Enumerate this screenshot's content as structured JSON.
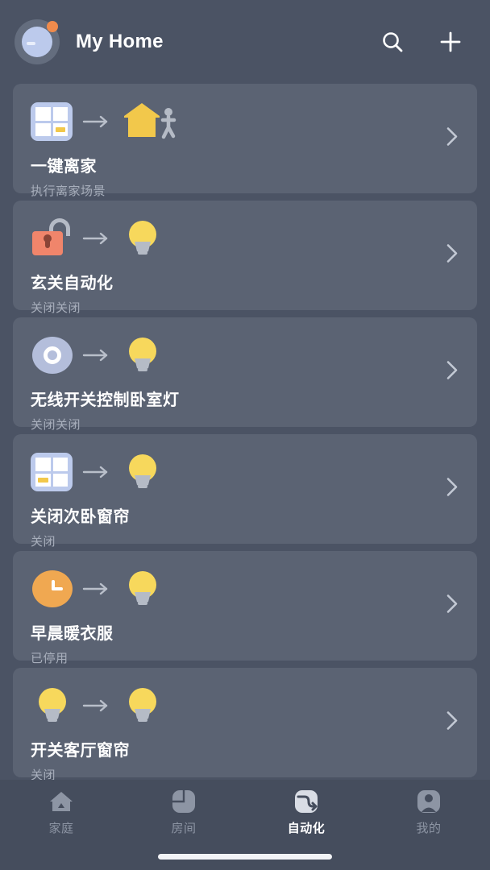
{
  "header": {
    "title": "My Home",
    "avatar_name": "user-avatar",
    "notification_dot_color": "#f08b4c",
    "search_label": "search-icon",
    "add_label": "add-icon"
  },
  "colors": {
    "background": "#4b5364",
    "card": "#5b6373",
    "nav_background": "#454d5d",
    "accent_yellow": "#f7d85c",
    "accent_orange": "#f0a851",
    "accent_salmon": "#f0856b",
    "accent_blue": "#bccaec",
    "title_text": "#ffffff",
    "subtitle_text": "#a7aebb"
  },
  "automations": [
    {
      "title": "一键离家",
      "subtitle": "执行离家场景",
      "trigger_icon": "panel-switch-icon",
      "action_icon": "house-leaving-icon",
      "arrow_icon": "arrow-right-icon",
      "chevron_icon": "chevron-right-icon"
    },
    {
      "title": "玄关自动化",
      "subtitle": "关闭关闭",
      "trigger_icon": "unlocked-padlock-icon",
      "action_icon": "lightbulb-icon",
      "arrow_icon": "arrow-right-icon",
      "chevron_icon": "chevron-right-icon"
    },
    {
      "title": "无线开关控制卧室灯",
      "subtitle": "关闭关闭",
      "trigger_icon": "wireless-switch-icon",
      "action_icon": "lightbulb-icon",
      "arrow_icon": "arrow-right-icon",
      "chevron_icon": "chevron-right-icon"
    },
    {
      "title": "关闭次卧窗帘",
      "subtitle": "关闭",
      "trigger_icon": "panel-switch-icon",
      "action_icon": "lightbulb-icon",
      "arrow_icon": "arrow-right-icon",
      "chevron_icon": "chevron-right-icon"
    },
    {
      "title": "早晨暖衣服",
      "subtitle": "已停用",
      "trigger_icon": "clock-icon",
      "action_icon": "lightbulb-icon",
      "arrow_icon": "arrow-right-icon",
      "chevron_icon": "chevron-right-icon"
    },
    {
      "title": "开关客厅窗帘",
      "subtitle": "关闭",
      "trigger_icon": "lightbulb-icon",
      "action_icon": "lightbulb-icon",
      "arrow_icon": "arrow-right-icon",
      "chevron_icon": "chevron-right-icon"
    }
  ],
  "bottom_nav": {
    "items": [
      {
        "label": "家庭",
        "icon": "home-icon",
        "active": false
      },
      {
        "label": "房间",
        "icon": "rooms-icon",
        "active": false
      },
      {
        "label": "自动化",
        "icon": "automation-icon",
        "active": true
      },
      {
        "label": "我的",
        "icon": "profile-icon",
        "active": false
      }
    ]
  }
}
